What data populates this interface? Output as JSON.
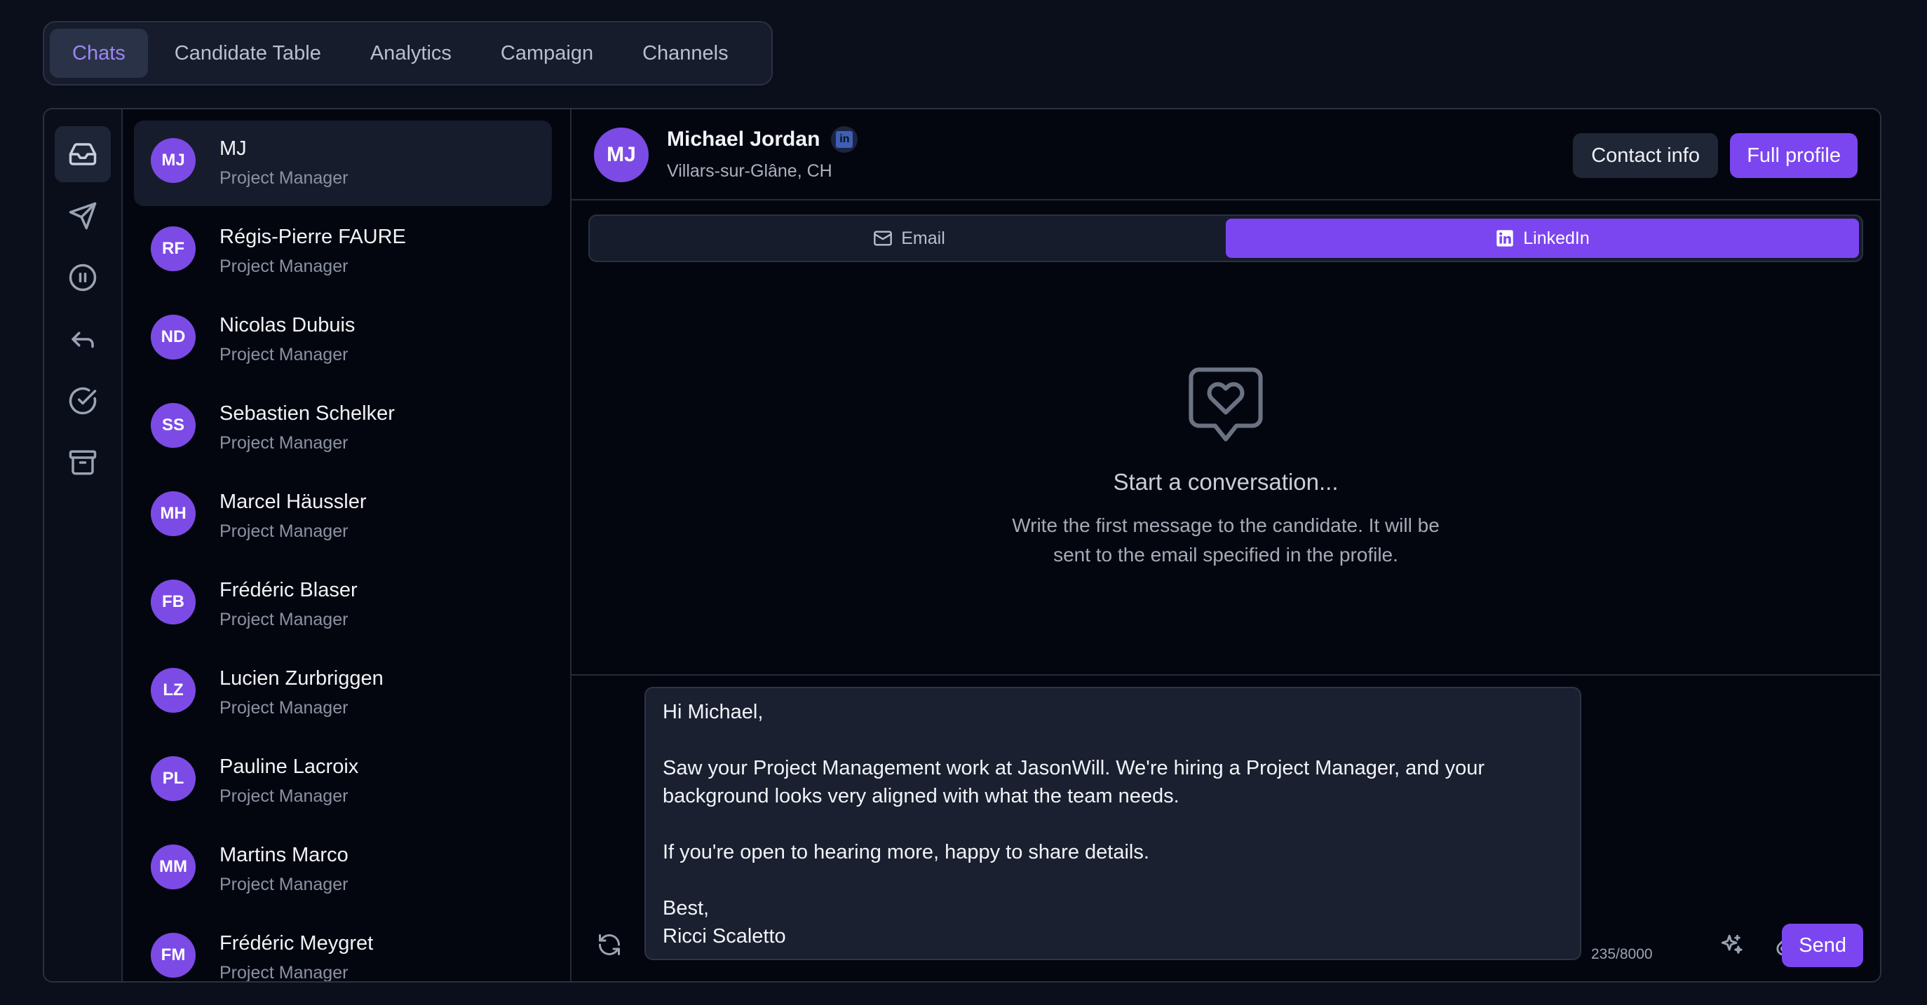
{
  "tabs": [
    {
      "label": "Chats",
      "active": true
    },
    {
      "label": "Candidate Table",
      "active": false
    },
    {
      "label": "Analytics",
      "active": false
    },
    {
      "label": "Campaign",
      "active": false
    },
    {
      "label": "Channels",
      "active": false
    }
  ],
  "rail": [
    "inbox-icon",
    "send-icon",
    "pause-icon",
    "reply-icon",
    "check-circle-icon",
    "archive-icon"
  ],
  "contacts": [
    {
      "initials": "MJ",
      "name": "MJ",
      "role": "Project Manager",
      "active": true
    },
    {
      "initials": "RF",
      "name": "Régis-Pierre FAURE",
      "role": "Project Manager"
    },
    {
      "initials": "ND",
      "name": "Nicolas Dubuis",
      "role": "Project Manager"
    },
    {
      "initials": "SS",
      "name": "Sebastien Schelker",
      "role": "Project Manager"
    },
    {
      "initials": "MH",
      "name": "Marcel Häussler",
      "role": "Project Manager"
    },
    {
      "initials": "FB",
      "name": "Frédéric Blaser",
      "role": "Project Manager"
    },
    {
      "initials": "LZ",
      "name": "Lucien Zurbriggen",
      "role": "Project Manager"
    },
    {
      "initials": "PL",
      "name": "Pauline Lacroix",
      "role": "Project Manager"
    },
    {
      "initials": "MM",
      "name": "Martins Marco",
      "role": "Project Manager"
    },
    {
      "initials": "FM",
      "name": "Frédéric Meygret",
      "role": "Project Manager"
    }
  ],
  "header": {
    "initials": "MJ",
    "name": "Michael Jordan",
    "location": "Villars-sur-Glâne, CH",
    "contact_info_label": "Contact info",
    "full_profile_label": "Full profile"
  },
  "channels": {
    "email_label": "Email",
    "linkedin_label": "LinkedIn",
    "active": "LinkedIn"
  },
  "empty_state": {
    "title": "Start a conversation...",
    "description": "Write the first message to the candidate. It will be sent to the email specified in the profile."
  },
  "composer": {
    "message": "Hi Michael,\n\nSaw your Project Management work at JasonWill. We're hiring a Project Manager, and your background looks very aligned with what the team needs.\n\nIf you're open to hearing more, happy to share details.\n\nBest,\nRicci Scaletto",
    "counter": "235/8000",
    "send_label": "Send"
  },
  "colors": {
    "accent": "#7b46f0",
    "avatar": "#7c4be6",
    "background": "#0b0f1c"
  }
}
